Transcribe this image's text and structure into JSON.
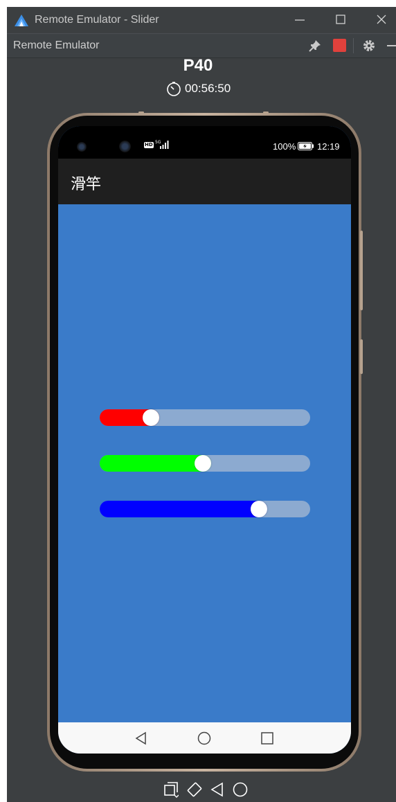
{
  "window": {
    "title": "Remote Emulator - Slider",
    "toolbar_title": "Remote Emulator"
  },
  "device": {
    "name": "P40",
    "timer": "00:56:50"
  },
  "status_bar": {
    "hd": "HD",
    "network": "5G",
    "battery": "100%",
    "time": "12:19"
  },
  "app": {
    "title": "滑竿"
  },
  "sliders": [
    {
      "name": "red",
      "color": "#ff0000",
      "value": 0.22
    },
    {
      "name": "green",
      "color": "#00ff00",
      "value": 0.49
    },
    {
      "name": "blue",
      "color": "#0000ff",
      "value": 0.78
    }
  ],
  "colors": {
    "content_bg": "#3a7bc9",
    "track": "#8caad0",
    "stop_button": "#e0413c"
  },
  "icons": [
    "app-logo-icon",
    "minimize-icon",
    "maximize-icon",
    "close-icon",
    "pin-icon",
    "stop-icon",
    "gear-icon",
    "timer-icon",
    "back-icon",
    "home-icon",
    "recent-icon",
    "rotate-icon",
    "screenshot-icon"
  ]
}
